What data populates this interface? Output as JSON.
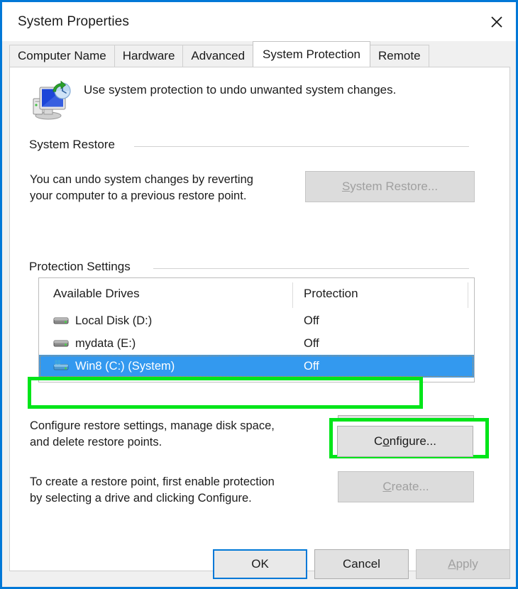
{
  "window": {
    "title": "System Properties",
    "close_label": "Close",
    "accent_color": "#0078d7",
    "annotation_color": "#00e519"
  },
  "tabs": [
    {
      "label": "Computer Name",
      "active": false
    },
    {
      "label": "Hardware",
      "active": false
    },
    {
      "label": "Advanced",
      "active": false
    },
    {
      "label": "System Protection",
      "active": true
    },
    {
      "label": "Remote",
      "active": false
    }
  ],
  "header": {
    "icon": "system-protection-monitor-icon",
    "blurb": "Use system protection to undo unwanted system changes."
  },
  "system_restore": {
    "group_label": "System Restore",
    "description": "You can undo system changes by reverting your computer to a previous restore point.",
    "description_line1": "You can undo system changes by reverting",
    "description_line2": "your computer to a previous restore point.",
    "button": {
      "label": "System Restore...",
      "accelerator": "S",
      "enabled": false
    }
  },
  "protection_settings": {
    "group_label": "Protection Settings",
    "columns": [
      "Available Drives",
      "Protection"
    ],
    "drives": [
      {
        "name": "Local Disk (D:)",
        "protection": "Off",
        "icon": "hard-drive-icon",
        "selected": false,
        "system": false
      },
      {
        "name": "mydata (E:)",
        "protection": "Off",
        "icon": "hard-drive-icon",
        "selected": false,
        "system": false
      },
      {
        "name": "Win8 (C:) (System)",
        "protection": "Off",
        "icon": "system-drive-icon",
        "selected": true,
        "system": true
      }
    ],
    "configure": {
      "description_line1": "Configure restore settings, manage disk space,",
      "description_line2": "and delete restore points.",
      "button": {
        "label": "Configure...",
        "accelerator": "o",
        "enabled": true,
        "highlighted": true
      }
    },
    "create": {
      "description_line1": "To create a restore point, first enable protection",
      "description_line2": "by selecting a drive and clicking Configure.",
      "button": {
        "label": "Create...",
        "accelerator": "C",
        "enabled": false
      }
    }
  },
  "footer": {
    "ok": {
      "label": "OK",
      "enabled": true,
      "default": true
    },
    "cancel": {
      "label": "Cancel",
      "enabled": true,
      "default": false
    },
    "apply": {
      "label": "Apply",
      "accelerator": "A",
      "enabled": false,
      "default": false
    }
  },
  "annotations": [
    {
      "target": "selected-drive-row",
      "shape": "rectangle",
      "color": "#00e519"
    },
    {
      "target": "configure-button",
      "shape": "rectangle",
      "color": "#00e519"
    }
  ]
}
